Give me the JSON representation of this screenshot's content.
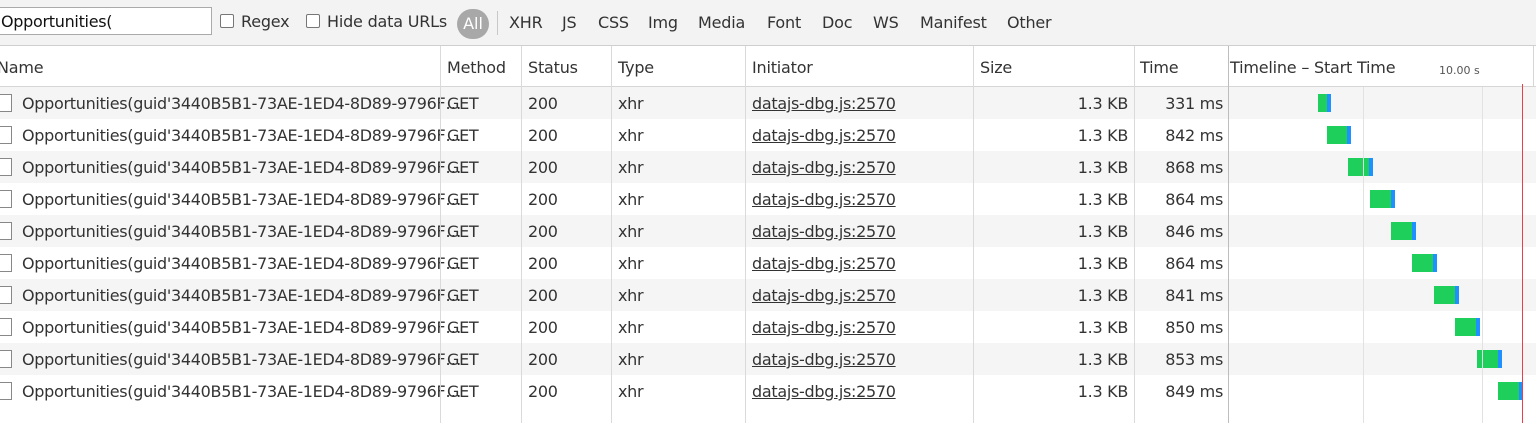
{
  "filter": {
    "value": "Opportunities(",
    "regex_label": "Regex",
    "hide_data_urls_label": "Hide data URLs",
    "types": [
      "All",
      "XHR",
      "JS",
      "CSS",
      "Img",
      "Media",
      "Font",
      "Doc",
      "WS",
      "Manifest",
      "Other"
    ],
    "selected_type": "All"
  },
  "columns": {
    "name": "Name",
    "method": "Method",
    "status": "Status",
    "type": "Type",
    "initiator": "Initiator",
    "size": "Size",
    "time": "Time",
    "timeline": "Timeline – Start Time",
    "timeline_scale": "10.00 s"
  },
  "rows": [
    {
      "name": "Opportunities(guid'3440B5B1-73AE-1ED4-8D89-9796F…",
      "method": "GET",
      "status": "200",
      "type": "xhr",
      "initiator": "datajs-dbg.js:2570",
      "size": "1.3 KB",
      "time": "331 ms"
    },
    {
      "name": "Opportunities(guid'3440B5B1-73AE-1ED4-8D89-9796F…",
      "method": "GET",
      "status": "200",
      "type": "xhr",
      "initiator": "datajs-dbg.js:2570",
      "size": "1.3 KB",
      "time": "842 ms"
    },
    {
      "name": "Opportunities(guid'3440B5B1-73AE-1ED4-8D89-9796F…",
      "method": "GET",
      "status": "200",
      "type": "xhr",
      "initiator": "datajs-dbg.js:2570",
      "size": "1.3 KB",
      "time": "868 ms"
    },
    {
      "name": "Opportunities(guid'3440B5B1-73AE-1ED4-8D89-9796F…",
      "method": "GET",
      "status": "200",
      "type": "xhr",
      "initiator": "datajs-dbg.js:2570",
      "size": "1.3 KB",
      "time": "864 ms"
    },
    {
      "name": "Opportunities(guid'3440B5B1-73AE-1ED4-8D89-9796F…",
      "method": "GET",
      "status": "200",
      "type": "xhr",
      "initiator": "datajs-dbg.js:2570",
      "size": "1.3 KB",
      "time": "846 ms"
    },
    {
      "name": "Opportunities(guid'3440B5B1-73AE-1ED4-8D89-9796F…",
      "method": "GET",
      "status": "200",
      "type": "xhr",
      "initiator": "datajs-dbg.js:2570",
      "size": "1.3 KB",
      "time": "864 ms"
    },
    {
      "name": "Opportunities(guid'3440B5B1-73AE-1ED4-8D89-9796F…",
      "method": "GET",
      "status": "200",
      "type": "xhr",
      "initiator": "datajs-dbg.js:2570",
      "size": "1.3 KB",
      "time": "841 ms"
    },
    {
      "name": "Opportunities(guid'3440B5B1-73AE-1ED4-8D89-9796F…",
      "method": "GET",
      "status": "200",
      "type": "xhr",
      "initiator": "datajs-dbg.js:2570",
      "size": "1.3 KB",
      "time": "850 ms"
    },
    {
      "name": "Opportunities(guid'3440B5B1-73AE-1ED4-8D89-9796F…",
      "method": "GET",
      "status": "200",
      "type": "xhr",
      "initiator": "datajs-dbg.js:2570",
      "size": "1.3 KB",
      "time": "853 ms"
    },
    {
      "name": "Opportunities(guid'3440B5B1-73AE-1ED4-8D89-9796F…",
      "method": "GET",
      "status": "200",
      "type": "xhr",
      "initiator": "datajs-dbg.js:2570",
      "size": "1.3 KB",
      "time": "849 ms"
    }
  ],
  "colors": {
    "waiting": "#1fcf5c",
    "download": "#1e90ff",
    "load_line": "#e8404a",
    "selected_filter": "#a8a8a8"
  },
  "icons": [
    "document-icon"
  ]
}
